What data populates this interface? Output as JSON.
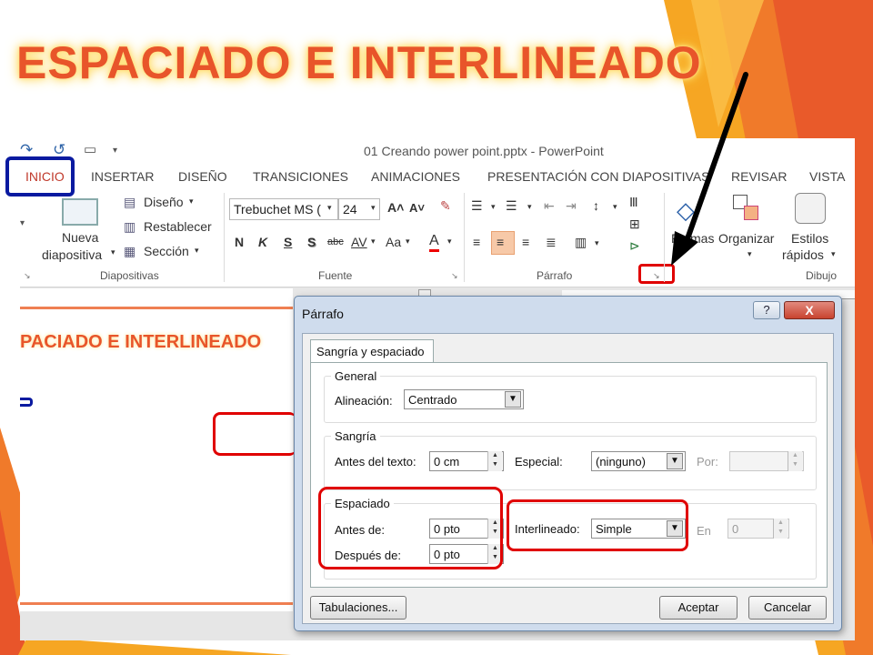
{
  "slide": {
    "title": "ESPACIADO E INTERLINEADO"
  },
  "window": {
    "title": "01 Creando power point.pptx - PowerPoint"
  },
  "tabs": [
    "INICIO",
    "INSERTAR",
    "DISEÑO",
    "TRANSICIONES",
    "ANIMACIONES",
    "PRESENTACIÓN CON DIAPOSITIVAS",
    "REVISAR",
    "VISTA"
  ],
  "ribbon": {
    "diapositivas": {
      "nueva": "Nueva",
      "diapositiva": "diapositiva",
      "diseno": "Diseño",
      "restablecer": "Restablecer",
      "seccion": "Sección",
      "group": "Diapositivas"
    },
    "fuente": {
      "font_name": "Trebuchet MS (",
      "font_size": "24",
      "bold": "N",
      "italic": "K",
      "underline": "S",
      "shadow": "S",
      "strike": "abc",
      "spacing": "AV",
      "case": "Aa",
      "color": "A",
      "group": "Fuente"
    },
    "parrafo": {
      "group": "Párrafo"
    },
    "dibujo": {
      "formas": "Formas",
      "organizar": "Organizar",
      "estilos": "Estilos",
      "rapidos": "rápidos",
      "group": "Dibujo"
    }
  },
  "slide_preview": {
    "title": "PACIADO E INTERLINEADO"
  },
  "dialog": {
    "title": "Párrafo",
    "tab": "Sangría y espaciado",
    "general": {
      "legend": "General",
      "alineacion_label": "Alineación:",
      "alineacion_value": "Centrado"
    },
    "sangria": {
      "legend": "Sangría",
      "antes_label": "Antes del texto:",
      "antes_value": "0 cm",
      "especial_label": "Especial:",
      "especial_value": "(ninguno)",
      "por_label": "Por:",
      "por_value": ""
    },
    "espaciado": {
      "legend": "Espaciado",
      "antes_label": "Antes de:",
      "antes_value": "0 pto",
      "despues_label": "Después de:",
      "despues_value": "0 pto",
      "interlineado_label": "Interlineado:",
      "interlineado_value": "Simple",
      "en_label": "En",
      "en_value": "0"
    },
    "buttons": {
      "tabulaciones": "Tabulaciones...",
      "aceptar": "Aceptar",
      "cancelar": "Cancelar",
      "help": "?",
      "close": "X"
    }
  }
}
